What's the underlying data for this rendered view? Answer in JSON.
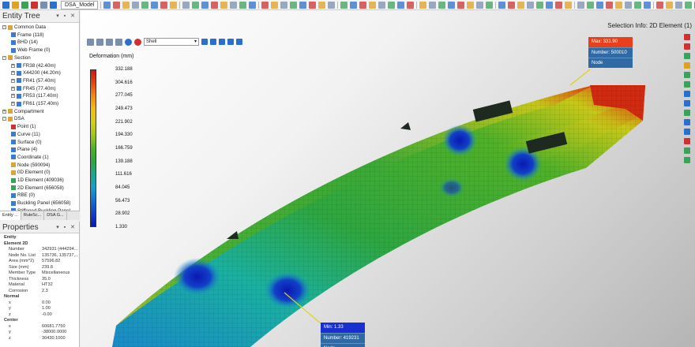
{
  "toolbar": {
    "document_tab": "DSA_Model",
    "icons": [
      "new-icon",
      "open-icon",
      "save-icon",
      "undo-icon",
      "redo-icon",
      "select-icon",
      "pick-icon",
      "measure-icon",
      "mesh-icon",
      "view-icon"
    ]
  },
  "entity_tree": {
    "title": "Entity Tree",
    "items": [
      {
        "label": "Common Data",
        "level": 0,
        "toggle": "-",
        "icon": "folder-icon",
        "color": "#d9a63a"
      },
      {
        "label": "Frame (118)",
        "level": 1,
        "icon": "frame-icon",
        "color": "#3a7bd5"
      },
      {
        "label": "BHD (14)",
        "level": 1,
        "icon": "bulkhead-icon",
        "color": "#3a7bd5"
      },
      {
        "label": "Web Frame (0)",
        "level": 1,
        "icon": "webframe-icon",
        "color": "#3a7bd5"
      },
      {
        "label": "Section",
        "level": 0,
        "toggle": "-",
        "icon": "section-icon",
        "color": "#d9a63a"
      },
      {
        "label": "FR38 (42.40m)",
        "level": 1,
        "toggle": "+",
        "icon": "section-item-icon",
        "color": "#3a7bd5"
      },
      {
        "label": "X44200 (44.20m)",
        "level": 1,
        "toggle": "+",
        "icon": "section-item-icon",
        "color": "#3a7bd5"
      },
      {
        "label": "FR41 (57.40m)",
        "level": 1,
        "toggle": "+",
        "icon": "section-item-icon",
        "color": "#3a7bd5"
      },
      {
        "label": "FR45 (77.40m)",
        "level": 1,
        "toggle": "+",
        "icon": "section-item-icon",
        "color": "#3a7bd5"
      },
      {
        "label": "FR53 (117.40m)",
        "level": 1,
        "toggle": "+",
        "icon": "section-item-icon",
        "color": "#3a7bd5"
      },
      {
        "label": "FR61 (157.40m)",
        "level": 1,
        "toggle": "+",
        "icon": "section-item-icon",
        "color": "#3a7bd5"
      },
      {
        "label": "Compartment",
        "level": 0,
        "toggle": "+",
        "icon": "compartment-icon",
        "color": "#d9a63a"
      },
      {
        "label": "DSA",
        "level": 0,
        "toggle": "-",
        "icon": "dsa-icon",
        "color": "#d9a63a"
      },
      {
        "label": "Point (1)",
        "level": 1,
        "icon": "point-icon",
        "color": "#d03030"
      },
      {
        "label": "Curve (11)",
        "level": 1,
        "icon": "curve-icon",
        "color": "#3a7bd5"
      },
      {
        "label": "Surface (0)",
        "level": 1,
        "icon": "surface-icon",
        "color": "#3a7bd5"
      },
      {
        "label": "Plane (4)",
        "level": 1,
        "icon": "plane-icon",
        "color": "#3a7bd5"
      },
      {
        "label": "Coordinate (1)",
        "level": 1,
        "icon": "coordinate-icon",
        "color": "#3a7bd5"
      },
      {
        "label": "Node (590094)",
        "level": 1,
        "icon": "node-icon",
        "color": "#d9a63a"
      },
      {
        "label": "0D Element (0)",
        "level": 1,
        "icon": "element-0d-icon",
        "color": "#d9a63a"
      },
      {
        "label": "1D Element (409036)",
        "level": 1,
        "icon": "element-1d-icon",
        "color": "#3aa35a"
      },
      {
        "label": "2D Element (656058)",
        "level": 1,
        "icon": "element-2d-icon",
        "color": "#3aa35a"
      },
      {
        "label": "RBE (0)",
        "level": 1,
        "icon": "rbe-icon",
        "color": "#3a7bd5"
      },
      {
        "label": "Buckling Panel (656058)",
        "level": 1,
        "icon": "buckling-panel-icon",
        "color": "#3a7bd5"
      },
      {
        "label": "Stiffened Buckling Panel",
        "level": 1,
        "icon": "stiffened-panel-icon",
        "color": "#3a7bd5"
      }
    ]
  },
  "panel_tabs": [
    "Entity ...",
    "RuleSc...",
    "DSA G..."
  ],
  "properties": {
    "title": "Properties",
    "rows": [
      {
        "k": "Entity",
        "v": "",
        "group": true
      },
      {
        "k": "Element 2D",
        "v": "",
        "group": true
      },
      {
        "k": "Number",
        "v": "342931 (444294..."
      },
      {
        "k": "Node No. List",
        "v": "135736, 135737,..."
      },
      {
        "k": "Area (mm^2)",
        "v": "57596.82"
      },
      {
        "k": "Size (mm)",
        "v": "239.8"
      },
      {
        "k": "Member Type",
        "v": "Miscellaneous"
      },
      {
        "k": "Thickness",
        "v": "35.0"
      },
      {
        "k": "Material",
        "v": "HT32"
      },
      {
        "k": "Corrosion",
        "v": "2.3"
      },
      {
        "k": "Normal",
        "v": "",
        "group": true
      },
      {
        "k": "x",
        "v": "0.00"
      },
      {
        "k": "y",
        "v": "1.00"
      },
      {
        "k": "z",
        "v": "-0.00"
      },
      {
        "k": "Center",
        "v": "",
        "group": true
      },
      {
        "k": "x",
        "v": "60681.7750"
      },
      {
        "k": "y",
        "v": "-38000.0000"
      },
      {
        "k": "z",
        "v": "30430.1000"
      }
    ]
  },
  "viewport": {
    "selection_info": "Selection Info: 2D Element (1)",
    "shell_select": "Shell",
    "legend": {
      "title": "Deformation (mm)",
      "labels": [
        "332.188",
        "304.616",
        "277.045",
        "249.473",
        "221.902",
        "194.330",
        "166.759",
        "139.188",
        "111.616",
        "84.045",
        "56.473",
        "28.902",
        "1.330"
      ],
      "colors": [
        "#c81818",
        "#e04a12",
        "#f08c10",
        "#f0c010",
        "#d4d010",
        "#a0c818",
        "#4fb028",
        "#2ea640",
        "#1aa88a",
        "#18a0c8",
        "#1670d0",
        "#1240c8",
        "#0a18b0"
      ]
    },
    "max_box": {
      "label": "Max: 331.90",
      "number": "Number: 500010",
      "type": "Node"
    },
    "min_box": {
      "label": "Min: 1.33",
      "number": "Number: 419231",
      "type": "Node"
    }
  }
}
